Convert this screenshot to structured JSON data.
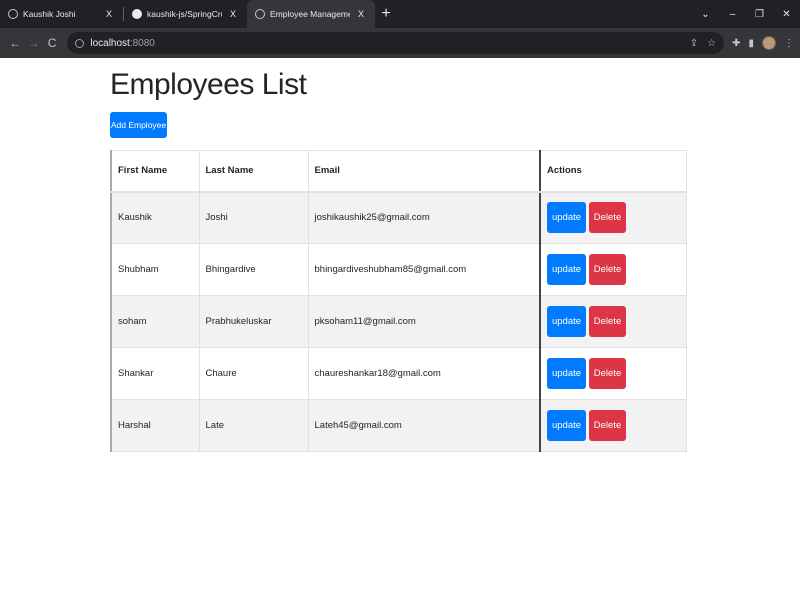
{
  "browser": {
    "tabs": [
      {
        "title": "Kaushik Joshi",
        "close": "X",
        "active": false,
        "icon": "profile-icon"
      },
      {
        "title": "kaushik-js/SpringCrud-Thymeleaf",
        "close": "X",
        "active": false,
        "icon": "github-icon"
      },
      {
        "title": "Employee Management System",
        "close": "X",
        "active": true,
        "icon": "globe-icon"
      }
    ],
    "new_tab": "+",
    "window_controls": {
      "menu": "⌄",
      "minimize": "–",
      "restore": "❐",
      "close": "✕"
    },
    "nav": {
      "back": "←",
      "forward": "→",
      "reload": "C"
    },
    "url_host": "localhost",
    "url_port": ":8080"
  },
  "page": {
    "title": "Employees List",
    "add_button": "Add Employee"
  },
  "table": {
    "headers": {
      "first_name": "First Name",
      "last_name": "Last Name",
      "email": "Email",
      "actions": "Actions"
    },
    "update_label": "update",
    "delete_label": "Delete",
    "rows": [
      {
        "first": "Kaushik",
        "last": "Joshi",
        "email": "joshikaushik25@gmail.com"
      },
      {
        "first": "Shubham",
        "last": "Bhingardive",
        "email": "bhingardiveshubham85@gmail.com"
      },
      {
        "first": "soham",
        "last": "Prabhukeluskar",
        "email": "pksoham11@gmail.com"
      },
      {
        "first": "Shankar",
        "last": "Chaure",
        "email": "chaureshankar18@gmail.com"
      },
      {
        "first": "Harshal",
        "last": "Late",
        "email": "Lateh45@gmail.com"
      }
    ]
  },
  "colors": {
    "primary": "#007bff",
    "danger": "#dc3545",
    "striped_row": "#f2f2f2"
  }
}
